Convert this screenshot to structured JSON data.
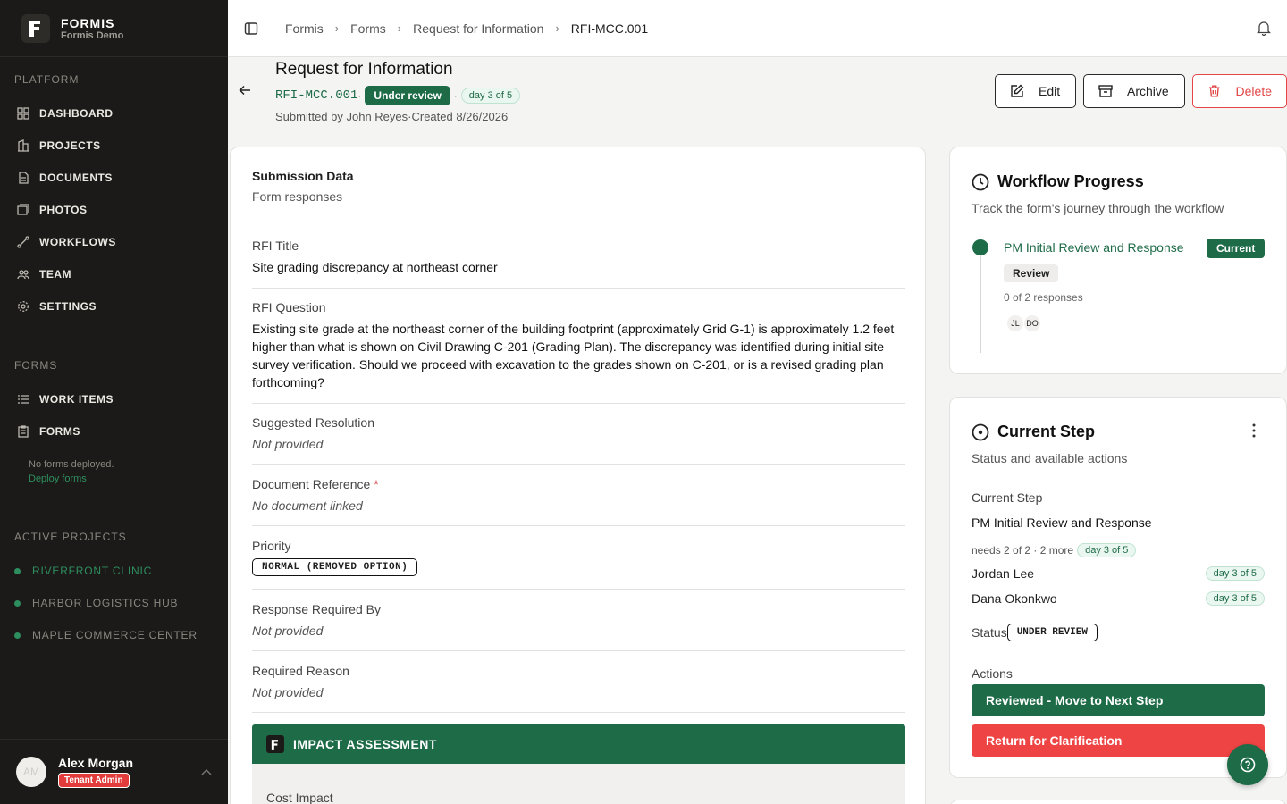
{
  "brand": {
    "name": "FORMIS",
    "sub": "Formis Demo"
  },
  "sidebar": {
    "platform_label": "PLATFORM",
    "platform_items": [
      {
        "label": "DASHBOARD",
        "icon": "grid-icon"
      },
      {
        "label": "PROJECTS",
        "icon": "building-icon"
      },
      {
        "label": "DOCUMENTS",
        "icon": "document-icon"
      },
      {
        "label": "PHOTOS",
        "icon": "photos-icon"
      },
      {
        "label": "WORKFLOWS",
        "icon": "workflow-icon"
      },
      {
        "label": "TEAM",
        "icon": "team-icon"
      },
      {
        "label": "SETTINGS",
        "icon": "gear-icon"
      }
    ],
    "forms_label": "FORMS",
    "forms_items": [
      {
        "label": "WORK ITEMS",
        "icon": "list-icon"
      },
      {
        "label": "FORMS",
        "icon": "clipboard-icon"
      }
    ],
    "no_forms": "No forms deployed.",
    "deploy_link": "Deploy forms",
    "active_label": "ACTIVE PROJECTS",
    "projects": [
      "RIVERFRONT CLINIC",
      "HARBOR LOGISTICS HUB",
      "MAPLE COMMERCE CENTER"
    ]
  },
  "user": {
    "initials": "AM",
    "name": "Alex Morgan",
    "role": "Tenant Admin"
  },
  "breadcrumb": [
    "Formis",
    "Forms",
    "Request for Information",
    "RFI-MCC.001"
  ],
  "header": {
    "title": "Request for Information",
    "rfi_id": "RFI-MCC.001",
    "status": "Under review",
    "day": "day 3 of 5",
    "submitted_by": "Submitted by John Reyes",
    "created": "Created 8/26/2026",
    "edit_label": "Edit",
    "archive_label": "Archive",
    "delete_label": "Delete"
  },
  "submission": {
    "title": "Submission Data",
    "desc": "Form responses",
    "fields": {
      "rfi_title": {
        "label": "RFI Title",
        "value": "Site grading discrepancy at northeast corner"
      },
      "rfi_question": {
        "label": "RFI Question",
        "value": "Existing site grade at the northeast corner of the building footprint (approximately Grid G-1) is approximately 1.2 feet higher than what is shown on Civil Drawing C-201 (Grading Plan). The discrepancy was identified during initial site survey verification. Should we proceed with excavation to the grades shown on C-201, or is a revised grading plan forthcoming?"
      },
      "suggested_resolution": {
        "label": "Suggested Resolution",
        "value": "Not provided"
      },
      "document_reference": {
        "label": "Document Reference",
        "required": "*",
        "value": "No document linked"
      },
      "priority": {
        "label": "Priority",
        "value": "NORMAL (REMOVED OPTION)"
      },
      "response_required_by": {
        "label": "Response Required By",
        "value": "Not provided"
      },
      "required_reason": {
        "label": "Required Reason",
        "value": "Not provided"
      }
    },
    "impact_title": "IMPACT ASSESSMENT",
    "cost_impact_label": "Cost Impact"
  },
  "workflow": {
    "title": "Workflow Progress",
    "desc": "Track the form's journey through the workflow",
    "step_name": "PM Initial Review and Response",
    "current_label": "Current",
    "step_type": "Review",
    "responses": "0 of 2 responses",
    "assignees": [
      "JL",
      "DO"
    ]
  },
  "current_step": {
    "title": "Current Step",
    "desc": "Status and available actions",
    "label": "Current Step",
    "name": "PM Initial Review and Response",
    "needs": "needs 2 of 2 · 2 more",
    "day": "day 3 of 5",
    "people": [
      {
        "name": "Jordan Lee",
        "day": "day 3 of 5"
      },
      {
        "name": "Dana Okonkwo",
        "day": "day 3 of 5"
      }
    ],
    "status_label": "Status",
    "status_value": "UNDER REVIEW",
    "actions_label": "Actions",
    "primary_action": "Reviewed - Move to Next Step",
    "secondary_action": "Return for Clarification"
  },
  "colors": {
    "brand_green": "#1e6b47",
    "danger": "#e24646",
    "sidebar_bg": "#1c1a18"
  }
}
